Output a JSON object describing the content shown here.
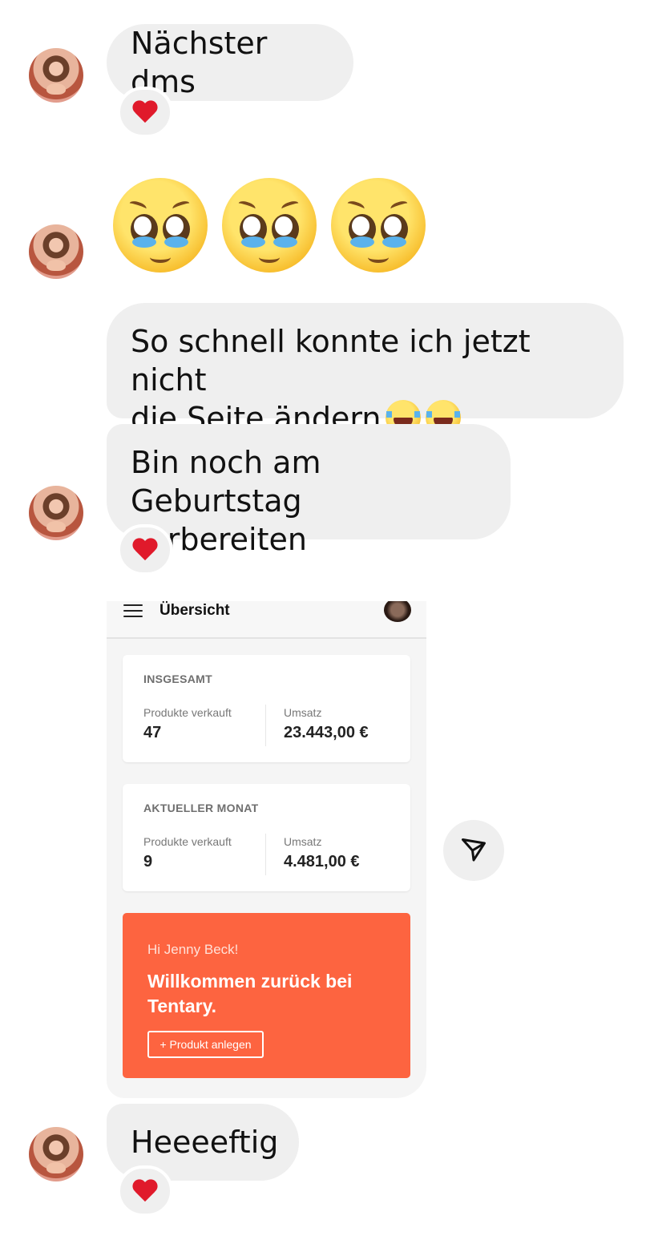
{
  "messages": {
    "m1": "Nächster dms",
    "m3_line1": "So schnell konnte ich jetzt nicht",
    "m3_line2": "die Seite ändern",
    "m4_line1": "Bin noch am Geburtstag",
    "m4_line2": "vorbereiten",
    "m5": "Heeeeftig"
  },
  "reactions": {
    "heart": "heart-emoji"
  },
  "emoji": {
    "big_row": [
      "pleading-face",
      "pleading-face",
      "pleading-face"
    ],
    "inline": [
      "face-with-tears-of-joy",
      "face-with-tears-of-joy"
    ]
  },
  "shared_screenshot": {
    "title": "Übersicht",
    "total": {
      "caption": "INSGESAMT",
      "products_label": "Produkte verkauft",
      "products_value": "47",
      "revenue_label": "Umsatz",
      "revenue_value": "23.443,00 €"
    },
    "month": {
      "caption": "AKTUELLER MONAT",
      "products_label": "Produkte verkauft",
      "products_value": "9",
      "revenue_label": "Umsatz",
      "revenue_value": "4.481,00 €"
    },
    "promo": {
      "greeting": "Hi Jenny Beck!",
      "headline": "Willkommen zurück bei Tentary.",
      "button": "+ Produkt anlegen",
      "color": "#fd6440"
    }
  },
  "icons": {
    "share": "send-icon",
    "menu": "menu-icon"
  }
}
